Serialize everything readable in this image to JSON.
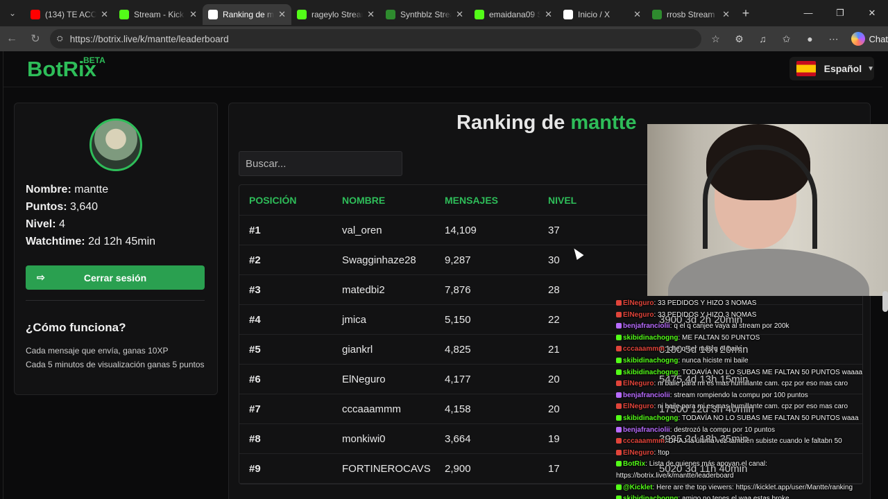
{
  "browser": {
    "tabs": [
      {
        "title": "(134) TE ACORD",
        "icon": "youtube-icon",
        "color": "#ff0000"
      },
      {
        "title": "Stream - Kick D",
        "icon": "kick-icon",
        "color": "#53fc18"
      },
      {
        "title": "Ranking de ma",
        "icon": "botrix-icon",
        "color": "#ffffff",
        "active": true
      },
      {
        "title": "rageylo Stream",
        "icon": "kick-icon",
        "color": "#53fc18"
      },
      {
        "title": "Synthblz Stream",
        "icon": "kick-icon",
        "color": "#2e8b2e"
      },
      {
        "title": "emaidana09 Str",
        "icon": "kick-icon",
        "color": "#53fc18"
      },
      {
        "title": "Inicio / X",
        "icon": "x-icon",
        "color": "#ffffff"
      },
      {
        "title": "rrosb Stream",
        "icon": "kick-icon",
        "color": "#2e8b2e"
      }
    ],
    "url": "https://botrix.live/k/mantte/leaderboard",
    "chat_label": "Chat"
  },
  "site": {
    "logo": "BotRix",
    "beta": "BETA",
    "language": "Español"
  },
  "profile": {
    "name_label": "Nombre:",
    "name": "mantte",
    "points_label": "Puntos:",
    "points": "3,640",
    "level_label": "Nivel:",
    "level": "4",
    "watch_label": "Watchtime:",
    "watch": "2d 12h 45min",
    "logout": "Cerrar sesión",
    "how_title": "¿Cómo funciona?",
    "how_lines": [
      "Cada mensaje que envía, ganas 10XP",
      "Cada 5 minutos de visualización ganas 5 puntos"
    ]
  },
  "ranking": {
    "title_prefix": "Ranking de",
    "title_name": "mantte",
    "search_placeholder": "Buscar...",
    "headers": [
      "POSICIÓN",
      "NOMBRE",
      "MENSAJES",
      "NIVEL"
    ],
    "rows": [
      [
        "#1",
        "val_oren",
        "14,109",
        "37"
      ],
      [
        "#2",
        "Swagginhaze28",
        "9,287",
        "30"
      ],
      [
        "#3",
        "matedbi2",
        "7,876",
        "28"
      ],
      [
        "#4",
        "jmica",
        "5,150",
        "22"
      ],
      [
        "#5",
        "giankrl",
        "4,825",
        "21"
      ],
      [
        "#6",
        "ElNeguro",
        "4,177",
        "20"
      ],
      [
        "#7",
        "cccaaammm",
        "4,158",
        "20"
      ],
      [
        "#8",
        "monkiwi0",
        "3,664",
        "19"
      ],
      [
        "#9",
        "FORTINEROCAVS",
        "2,900",
        "17"
      ]
    ],
    "ghost_values": [
      "3900  3d 2h 20min",
      "8180  5d 16h 20min",
      "5475  4d 13h 15min",
      "17500  12d 3h 40min",
      "3995  2d 18h 35min",
      "5020  3d 11h 40min"
    ]
  },
  "chat": [
    {
      "user": "ElNeguro",
      "color": "#e0443a",
      "text": ": 33 PEDIDOS Y HIZO 3 NOMAS"
    },
    {
      "user": "ElNeguro",
      "color": "#e0443a",
      "text": ": 33 PEDIDOS Y HIZO 3 NOMAS"
    },
    {
      "user": "benjafranciolii",
      "color": "#b86bff",
      "text": ": q el q canjee vaya al stream por 200k"
    },
    {
      "user": "skibidinachogng",
      "color": "#53fc18",
      "text": ": ME FALTAN 50 PUNTOS"
    },
    {
      "user": "cccaaammm",
      "color": "#e0443a",
      "text": ": che q ser más q el baile"
    },
    {
      "user": "skibidinachogng",
      "color": "#53fc18",
      "text": ": nunca hiciste mi baile"
    },
    {
      "user": "skibidinachogng",
      "color": "#53fc18",
      "text": ": TODAVÍA NO LO SUBAS ME FALTAN 50 PUNTOS waaaa"
    },
    {
      "user": "ElNeguro",
      "color": "#e0443a",
      "text": ": ni baile para mi es mas humillante cam. cpz por eso mas caro"
    },
    {
      "user": "benjafranciolii",
      "color": "#b86bff",
      "text": ": stream rompiendo la compu por 100 puntos"
    },
    {
      "user": "ElNeguro",
      "color": "#e0443a",
      "text": ": ni baile para mi es mas humillante cam. cpz por eso mas caro"
    },
    {
      "user": "skibidinachogng",
      "color": "#53fc18",
      "text": ": TODAVÍA NO LO SUBAS ME FALTAN 50 PUNTOS waaa"
    },
    {
      "user": "benjafranciolii",
      "color": "#b86bff",
      "text": ": destrozó la compu por 10 puntos"
    },
    {
      "user": "cccaaammm",
      "color": "#e0443a",
      "text": ": DHAJ la última vez también subiste cuando le faltabn 50"
    },
    {
      "user": "ElNeguro",
      "color": "#e0443a",
      "text": ": !top"
    },
    {
      "user": "BotRix",
      "color": "#53fc18",
      "text": ": Lista de quienes más apoyan el canal:"
    },
    {
      "user": "",
      "color": "#ffffff",
      "text": "https://botrix.live/k/mantte/leaderboard"
    },
    {
      "user": "@Kicklet",
      "color": "#53fc18",
      "text": ": Here are the top viewers: https://kicklet.app/user/Mantte/ranking"
    },
    {
      "user": "skibidinachogng",
      "color": "#53fc18",
      "text": ": amigo no tenes el waa estas broke"
    }
  ]
}
